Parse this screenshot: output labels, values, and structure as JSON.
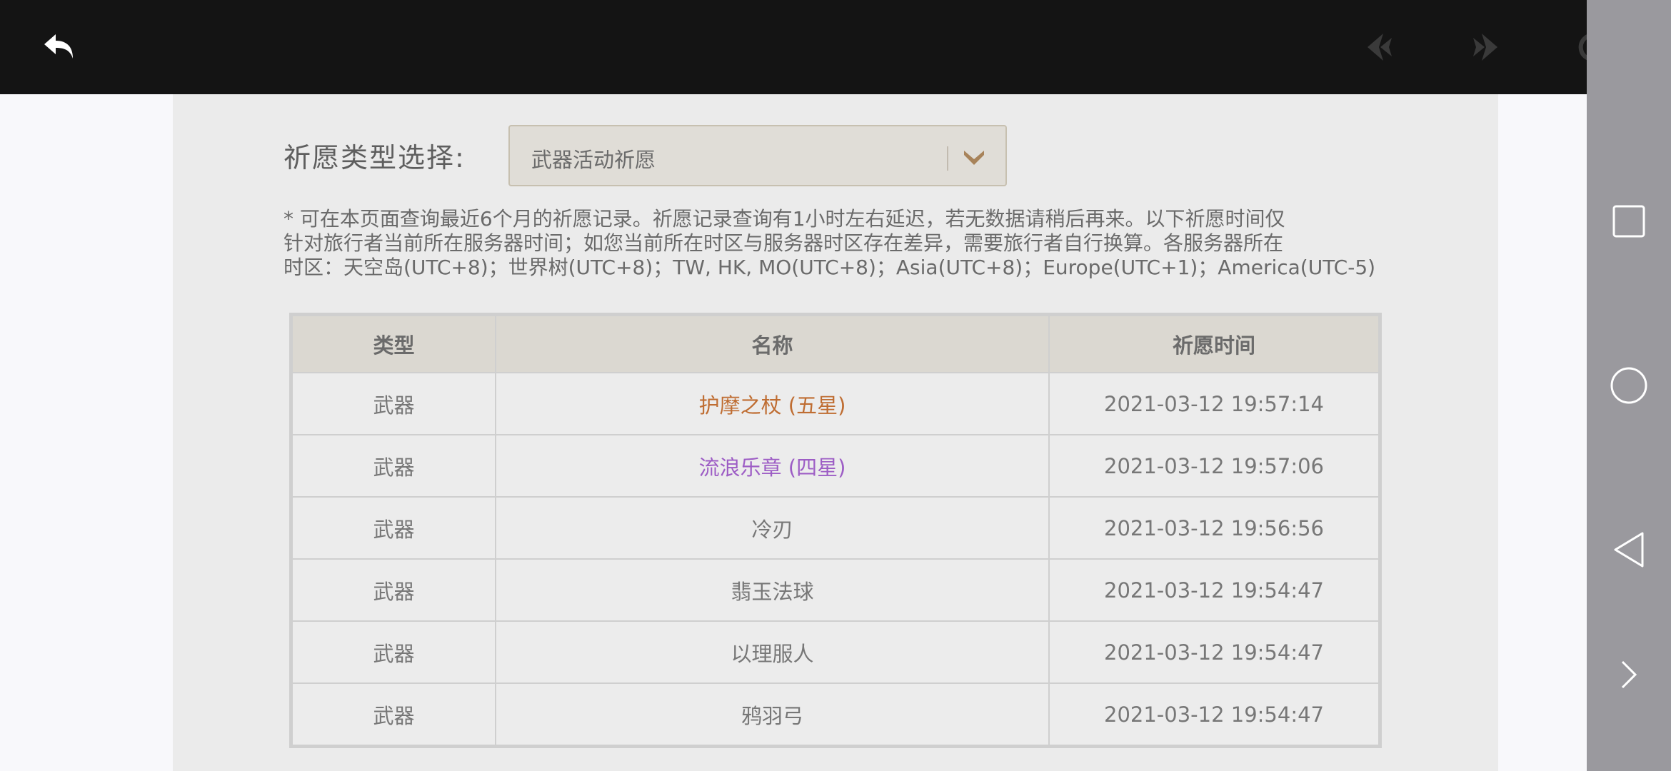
{
  "toolbar": {
    "back_icon": "back-arrow-icon",
    "prev_icon": "prev-arrow-icon",
    "next_icon": "next-arrow-icon",
    "refresh_icon": "refresh-icon"
  },
  "filter": {
    "label": "祈愿类型选择:",
    "selected": "武器活动祈愿"
  },
  "notice": {
    "line1": "* 可在本页面查询最近6个月的祈愿记录。祈愿记录查询有1小时左右延迟，若无数据请稍后再来。以下祈愿时间仅",
    "line2": "针对旅行者当前所在服务器时间；如您当前所在时区与服务器时区存在差异，需要旅行者自行换算。各服务器所在",
    "line3": "时区：天空岛(UTC+8)；世界树(UTC+8)；TW, HK, MO(UTC+8)；Asia(UTC+8)；Europe(UTC+1)；America(UTC-5)"
  },
  "table": {
    "headers": [
      "类型",
      "名称",
      "祈愿时间"
    ],
    "rows": [
      {
        "type": "武器",
        "name": "护摩之杖 (五星)",
        "time": "2021-03-12 19:57:14",
        "rarity": "five"
      },
      {
        "type": "武器",
        "name": "流浪乐章 (四星)",
        "time": "2021-03-12 19:57:06",
        "rarity": "four"
      },
      {
        "type": "武器",
        "name": "冷刃",
        "time": "2021-03-12 19:56:56",
        "rarity": "three"
      },
      {
        "type": "武器",
        "name": "翡玉法球",
        "time": "2021-03-12 19:54:47",
        "rarity": "three"
      },
      {
        "type": "武器",
        "name": "以理服人",
        "time": "2021-03-12 19:54:47",
        "rarity": "three"
      },
      {
        "type": "武器",
        "name": "鸦羽弓",
        "time": "2021-03-12 19:54:47",
        "rarity": "three"
      }
    ]
  },
  "colors": {
    "five_star": "#bf6d32",
    "four_star": "#9d5dc5"
  }
}
